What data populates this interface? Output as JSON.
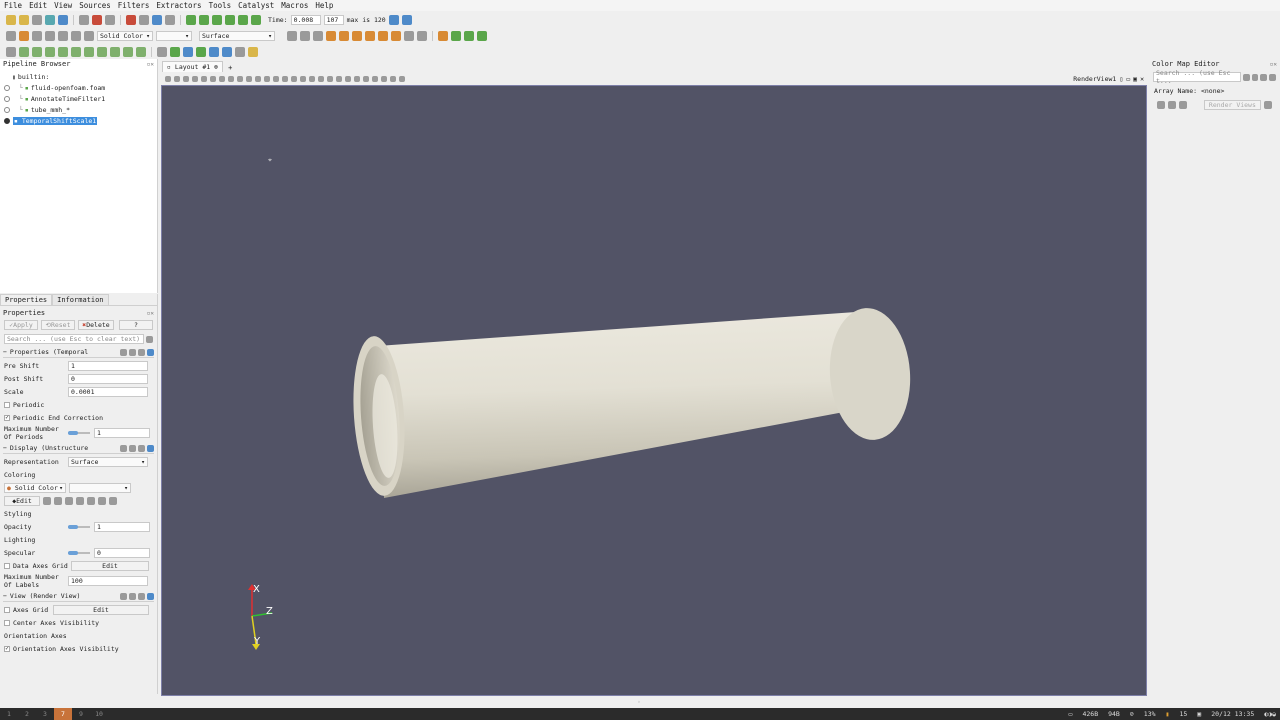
{
  "menu": [
    "File",
    "Edit",
    "View",
    "Sources",
    "Filters",
    "Extractors",
    "Tools",
    "Catalyst",
    "Macros",
    "Help"
  ],
  "time": {
    "label": "Time:",
    "value": "0.008",
    "index": "107",
    "max_label": "max is 120"
  },
  "toolbar": {
    "color_by": "Solid Color",
    "representation": "Surface"
  },
  "pipeline": {
    "title": "Pipeline Browser",
    "items": [
      {
        "label": "builtin:"
      },
      {
        "label": "fluid-openfoam.foam"
      },
      {
        "label": "AnnotateTimeFilter1"
      },
      {
        "label": "tube_mmh_*"
      },
      {
        "label": "TemporalShiftScale1"
      }
    ]
  },
  "tabs": {
    "properties": "Properties",
    "information": "Information"
  },
  "props": {
    "title": "Properties",
    "apply": "Apply",
    "reset": "Reset",
    "delete": "Delete",
    "help": "?",
    "search_placeholder": "Search ... (use Esc to clear text)",
    "section_props": "Properties (Temporal",
    "pre_shift_label": "Pre Shift",
    "pre_shift": "1",
    "post_shift_label": "Post Shift",
    "post_shift": "0",
    "scale_label": "Scale",
    "scale": "0.0001",
    "periodic": "Periodic",
    "periodic_end": "Periodic End Correction",
    "max_periods_label": "Maximum Number Of Periods",
    "max_periods": "1",
    "section_display": "Display (Unstructure",
    "representation_label": "Representation",
    "representation": "Surface",
    "coloring": "Coloring",
    "solid_color": "Solid Color",
    "edit": "Edit",
    "styling": "Styling",
    "opacity_label": "Opacity",
    "opacity": "1",
    "lighting": "Lighting",
    "specular_label": "Specular",
    "specular": "0",
    "data_axes_grid": "Data Axes Grid",
    "max_labels_label": "Maximum Number Of Labels",
    "max_labels": "100",
    "section_view": "View (Render View)",
    "axes_grid": "Axes Grid",
    "center_axes": "Center Axes Visibility",
    "orientation_axes": "Orientation Axes",
    "orientation_vis": "Orientation Axes Visibility"
  },
  "layout": {
    "tab": "Layout #1",
    "view_name": "RenderView1"
  },
  "axes": {
    "x": "X",
    "y": "Y",
    "z": "Z"
  },
  "colormap": {
    "title": "Color Map Editor",
    "search_placeholder": "Search ... (use Esc t...",
    "array_name": "Array Name: <none>",
    "render_views": "Render Views"
  },
  "taskbar": {
    "workspaces": [
      "1",
      "2",
      "3",
      "7",
      "9",
      "10"
    ],
    "mem": "426B",
    "cpu": "94B",
    "pct": "13%",
    "n": "15",
    "datetime": "20/12 13:35"
  },
  "colors": {
    "viewport": "#525366",
    "selection": "#3d8ede",
    "tube": "#e2dfd3"
  }
}
